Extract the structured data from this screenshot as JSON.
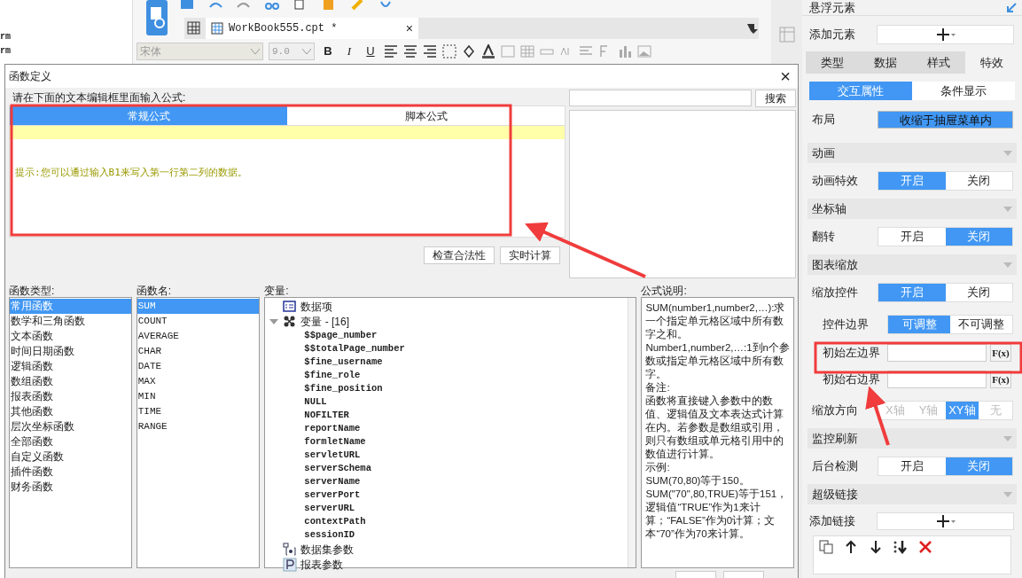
{
  "left_strip": {
    "texts": [
      "rm",
      "rm"
    ]
  },
  "toolbar": {
    "tab": {
      "label": "WorkBook555.cpt *",
      "close": "×"
    },
    "font": "宋体",
    "size": "9.0",
    "format_buttons": [
      "B",
      "I",
      "U"
    ]
  },
  "dialog": {
    "title": "函数定义",
    "close": "×",
    "prompt": "请在下面的文本编辑框里面输入公式:",
    "search_button": "搜索",
    "editor_tabs": [
      {
        "label": "常规公式",
        "selected": true
      },
      {
        "label": "脚本公式",
        "selected": false
      }
    ],
    "hint": "提示:您可以通过输入B1来写入第一行第二列的数据。",
    "buttons": [
      "检查合法性",
      "实时计算"
    ],
    "labels": [
      "函数类型:",
      "函数名:",
      "变量:",
      "公式说明:"
    ],
    "function_types": [
      {
        "label": "常用函数",
        "selected": true
      },
      {
        "label": "数学和三角函数",
        "selected": false
      },
      {
        "label": "文本函数",
        "selected": false
      },
      {
        "label": "时间日期函数",
        "selected": false
      },
      {
        "label": "逻辑函数",
        "selected": false
      },
      {
        "label": "数组函数",
        "selected": false
      },
      {
        "label": "报表函数",
        "selected": false
      },
      {
        "label": "其他函数",
        "selected": false
      },
      {
        "label": "层次坐标函数",
        "selected": false
      },
      {
        "label": "全部函数",
        "selected": false
      },
      {
        "label": "自定义函数",
        "selected": false
      },
      {
        "label": "插件函数",
        "selected": false
      },
      {
        "label": "财务函数",
        "selected": false
      }
    ],
    "function_names": [
      {
        "label": "SUM",
        "selected": true
      },
      {
        "label": "COUNT",
        "selected": false
      },
      {
        "label": "AVERAGE",
        "selected": false
      },
      {
        "label": "CHAR",
        "selected": false
      },
      {
        "label": "DATE",
        "selected": false
      },
      {
        "label": "MAX",
        "selected": false
      },
      {
        "label": "MIN",
        "selected": false
      },
      {
        "label": "TIME",
        "selected": false
      },
      {
        "label": "RANGE",
        "selected": false
      }
    ],
    "variables": [
      {
        "kind": "data_item",
        "label": "数据项"
      },
      {
        "kind": "variable",
        "label": "变量 - [16]",
        "expanded": true,
        "children": [
          {
            "label": "$$page_number"
          },
          {
            "label": "$$totalPage_number"
          },
          {
            "label": "$fine_username"
          },
          {
            "label": "$fine_role"
          },
          {
            "label": "$fine_position"
          },
          {
            "label": "NULL"
          },
          {
            "label": "NOFILTER"
          },
          {
            "label": "reportName"
          },
          {
            "label": "formletName"
          },
          {
            "label": "servletURL"
          },
          {
            "label": "serverSchema"
          },
          {
            "label": "serverName"
          },
          {
            "label": "serverPort"
          },
          {
            "label": "serverURL"
          },
          {
            "label": "contextPath"
          },
          {
            "label": "sessionID"
          }
        ]
      },
      {
        "kind": "dataset_param",
        "label": "数据集参数"
      },
      {
        "kind": "report_param",
        "label": "报表参数"
      }
    ],
    "description": [
      "SUM(number1,number2,…):求一个指定单元格区域中所有数字之和。",
      "Number1,number2,…:1到n个参数或指定单元格区域中所有数字。",
      "备注:",
      "函数将直接键入参数中的数值、逻辑值及文本表达式计算在内。若参数是数组或引用，则只有数组或单元格引用中的数值进行计算。",
      "示例:",
      "SUM(70,80)等于150。",
      "SUM(\"70\",80,TRUE)等于151，逻辑值“TRUE”作为1来计算；“FALSE”作为0计算；文本“70”作为70来计算。"
    ]
  },
  "properties_panel": {
    "title": "悬浮元素",
    "tabs": [
      {
        "label": "类型",
        "selected": false
      },
      {
        "label": "数据",
        "selected": false
      },
      {
        "label": "样式",
        "selected": false
      },
      {
        "label": "特效",
        "selected": true
      }
    ],
    "subtabs": [
      {
        "label": "交互属性",
        "selected": true
      },
      {
        "label": "条件显示",
        "selected": false
      }
    ],
    "rows": [
      {
        "kind": "add",
        "label": "添加元素"
      },
      {
        "kind": "tabs"
      },
      {
        "kind": "subtabs"
      },
      {
        "kind": "select",
        "label": "布局",
        "value": "收缩于抽屉菜单内"
      },
      {
        "kind": "section",
        "label": "动画"
      },
      {
        "kind": "toggle",
        "label": "动画特效",
        "indent": false,
        "disabled": false,
        "options": [
          {
            "label": "开启",
            "selected": true
          },
          {
            "label": "关闭",
            "selected": false
          }
        ]
      },
      {
        "kind": "section",
        "label": "坐标轴"
      },
      {
        "kind": "toggle",
        "label": "翻转",
        "indent": false,
        "disabled": false,
        "options": [
          {
            "label": "开启",
            "selected": false
          },
          {
            "label": "关闭",
            "selected": true
          }
        ]
      },
      {
        "kind": "section",
        "label": "图表缩放"
      },
      {
        "kind": "toggle",
        "label": "缩放控件",
        "indent": false,
        "disabled": false,
        "options": [
          {
            "label": "开启",
            "selected": true
          },
          {
            "label": "关闭",
            "selected": false
          }
        ]
      },
      {
        "kind": "toggle",
        "label": "控件边界",
        "indent": true,
        "disabled": false,
        "options": [
          {
            "label": "可调整",
            "selected": true
          },
          {
            "label": "不可调整",
            "selected": false
          }
        ]
      },
      {
        "kind": "formula",
        "label": "初始左边界",
        "button": "F(x)"
      },
      {
        "kind": "formula",
        "label": "初始右边界",
        "button": "F(x)"
      },
      {
        "kind": "toggle",
        "label": "缩放方向",
        "indent": false,
        "disabled": true,
        "options": [
          {
            "label": "X轴",
            "selected": false
          },
          {
            "label": "Y轴",
            "selected": false
          },
          {
            "label": "XY轴",
            "selected": true
          },
          {
            "label": "无",
            "selected": false
          }
        ]
      },
      {
        "kind": "section",
        "label": "监控刷新"
      },
      {
        "kind": "toggle",
        "label": "后台检测",
        "indent": false,
        "disabled": false,
        "options": [
          {
            "label": "开启",
            "selected": false
          },
          {
            "label": "关闭",
            "selected": true
          }
        ]
      },
      {
        "kind": "section",
        "label": "超级链接"
      },
      {
        "kind": "add",
        "label": "添加链接"
      },
      {
        "kind": "link_list"
      }
    ]
  }
}
